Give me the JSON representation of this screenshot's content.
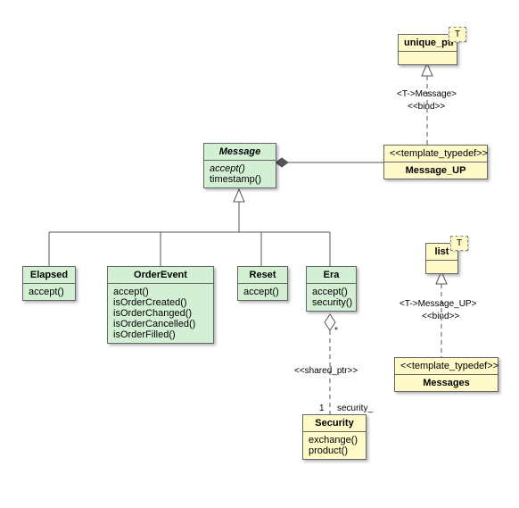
{
  "classes": {
    "unique_ptr": {
      "name": "unique_ptr",
      "param": "T"
    },
    "message_up": {
      "stereo": "<<template_typedef>>",
      "name": "Message_UP"
    },
    "message": {
      "name": "Message",
      "ops": [
        "accept()",
        "timestamp()"
      ]
    },
    "elapsed": {
      "name": "Elapsed",
      "ops": [
        "accept()"
      ]
    },
    "order_event": {
      "name": "OrderEvent",
      "ops": [
        "accept()",
        "isOrderCreated()",
        "isOrderChanged()",
        "isOrderCancelled()",
        "isOrderFilled()"
      ]
    },
    "reset": {
      "name": "Reset",
      "ops": [
        "accept()"
      ]
    },
    "era": {
      "name": "Era",
      "ops": [
        "accept()",
        "security()"
      ]
    },
    "list": {
      "name": "list",
      "param": "T"
    },
    "messages": {
      "stereo": "<<template_typedef>>",
      "name": "Messages"
    },
    "security": {
      "name": "Security",
      "ops": [
        "exchange()",
        "product()"
      ]
    }
  },
  "labels": {
    "bind_msg": "<T->Message>",
    "bind": "<<bind>>",
    "bind_up": "<T->Message_UP>",
    "shared_ptr": "<<shared_ptr>>",
    "one": "1",
    "star": "*",
    "security_role": "security_"
  }
}
